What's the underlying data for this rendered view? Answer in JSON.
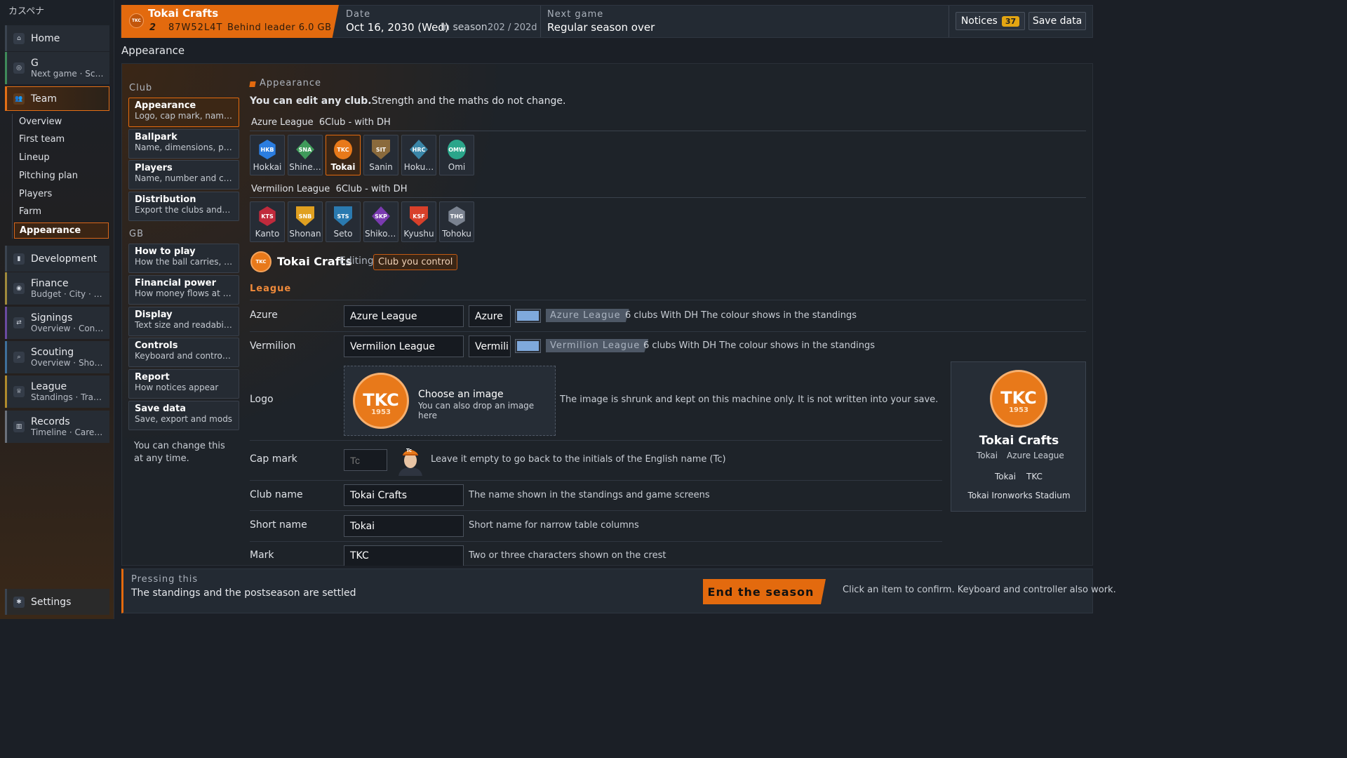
{
  "app": {
    "title": "カスペナ"
  },
  "sidebar": {
    "items": [
      {
        "label": "Home",
        "icon": "home-icon"
      },
      {
        "label": "G",
        "sub": "Next game · Sc…",
        "icon": "baseball-icon"
      },
      {
        "label": "Team",
        "icon": "team-icon"
      },
      {
        "label": "Development",
        "icon": "chart-icon"
      },
      {
        "label": "Finance",
        "sub": "Budget · City · B…",
        "icon": "coin-icon"
      },
      {
        "label": "Signings",
        "sub": "Overview · Cont…",
        "icon": "transfer-icon"
      },
      {
        "label": "Scouting",
        "sub": "Overview · Shor…",
        "icon": "search-icon"
      },
      {
        "label": "League",
        "sub": "Standings · Tran…",
        "icon": "trophy-icon"
      },
      {
        "label": "Records",
        "sub": "Timeline · Care…",
        "icon": "book-icon"
      }
    ],
    "team_sub": [
      "Overview",
      "First team",
      "Lineup",
      "Pitching plan",
      "Players",
      "Farm",
      "Appearance"
    ],
    "settings": "Settings"
  },
  "header": {
    "club_name": "Tokai Crafts",
    "club_rank": "2",
    "club_code": "87W52L4T",
    "club_status": "Behind leader 6.0 GB",
    "club_mark": "TKC",
    "date_label": "Date",
    "date_value": "Oct 16, 2030 (Wed)",
    "season_label": "In season",
    "season_progress": "202 / 202d",
    "next_label": "Next game",
    "next_value": "Regular season over",
    "notices_label": "Notices",
    "notices_count": "37",
    "save_label": "Save data"
  },
  "page": {
    "title": "Appearance"
  },
  "menu": {
    "club_label": "Club",
    "club_cards": [
      {
        "title": "Appearance",
        "desc": "Logo, cap mark, name…"
      },
      {
        "title": "Ballpark",
        "desc": "Name, dimensions, pa…"
      },
      {
        "title": "Players",
        "desc": "Name, number and ca…"
      },
      {
        "title": "Distribution",
        "desc": "Export the clubs and …"
      }
    ],
    "gb_label": "GB",
    "gb_cards": [
      {
        "title": "How to play",
        "desc": "How the ball carries, …"
      },
      {
        "title": "Financial power",
        "desc": "How money flows at e…"
      },
      {
        "title": "Display",
        "desc": "Text size and readability"
      },
      {
        "title": "Controls",
        "desc": "Keyboard and controller"
      },
      {
        "title": "Report",
        "desc": "How notices appear"
      },
      {
        "title": "Save data",
        "desc": "Save, export and mods"
      }
    ],
    "note": "You can change this at any time."
  },
  "appearance": {
    "section_label": "Appearance",
    "intro_bold": "You can edit any club.",
    "intro_rest": "Strength and the maths do not change.",
    "leagues": [
      {
        "name": "Azure League",
        "meta": "6Club - with DH",
        "clubs": [
          {
            "mark": "HKB",
            "name": "Hokkai",
            "color": "#2b7de0",
            "shape": "hex"
          },
          {
            "mark": "SNA",
            "name": "Shine…",
            "color": "#3f9a5a",
            "shape": "dia"
          },
          {
            "mark": "TKC",
            "name": "Tokai",
            "color": "#e8791a",
            "shape": "circle"
          },
          {
            "mark": "SIT",
            "name": "Sanin",
            "color": "#8a6a3c",
            "shape": "shield"
          },
          {
            "mark": "HRC",
            "name": "Hoku…",
            "color": "#3a86a8",
            "shape": "dia"
          },
          {
            "mark": "OMW",
            "name": "Omi",
            "color": "#2aa58a",
            "shape": "circle"
          }
        ]
      },
      {
        "name": "Vermilion League",
        "meta": "6Club - with DH",
        "clubs": [
          {
            "mark": "KTS",
            "name": "Kanto",
            "color": "#c02a3c",
            "shape": "hex"
          },
          {
            "mark": "SNB",
            "name": "Shonan",
            "color": "#e0a020",
            "shape": "shield"
          },
          {
            "mark": "STS",
            "name": "Seto",
            "color": "#2a7ab0",
            "shape": "shield"
          },
          {
            "mark": "SKP",
            "name": "Shikoku",
            "color": "#7a3ab0",
            "shape": "dia"
          },
          {
            "mark": "KSF",
            "name": "Kyushu",
            "color": "#d8402a",
            "shape": "shield"
          },
          {
            "mark": "THG",
            "name": "Tohoku",
            "color": "#7a8290",
            "shape": "hex"
          }
        ]
      }
    ],
    "editing": {
      "mark": "TKC",
      "name": "Tokai Crafts",
      "status": "Editing",
      "tag": "Club you control"
    },
    "league_section": "League",
    "league_rows": [
      {
        "label": "Azure",
        "full": "Azure League",
        "short": "Azure",
        "chip": "Azure League",
        "hint": "6 clubs With DH The colour shows in the standings",
        "color": "#7fa9dc"
      },
      {
        "label": "Vermilion",
        "full": "Vermilion League",
        "short": "Vermili",
        "chip": "Vermilion League",
        "hint": "6 clubs With DH The colour shows in the standings",
        "color": "#7fa9dc"
      }
    ],
    "logo": {
      "label": "Logo",
      "mark": "TKC",
      "year": "1953",
      "choose": "Choose an image",
      "drop": "You can also drop an image here",
      "hint": "The image is shrunk and kept on this machine only. It is not written into your save."
    },
    "cap": {
      "label": "Cap mark",
      "placeholder": "Tc",
      "avatar_mark": "Tc",
      "hint": "Leave it empty to go back to the initials of the English name (Tc)"
    },
    "fields": [
      {
        "label": "Club name",
        "value": "Tokai Crafts",
        "hint": "The name shown in the standings and game screens"
      },
      {
        "label": "Short name",
        "value": "Tokai",
        "hint": "Short name for narrow table columns"
      },
      {
        "label": "Mark",
        "value": "TKC",
        "hint": "Two or three characters shown on the crest"
      }
    ],
    "preview": {
      "mark": "TKC",
      "year": "1953",
      "name": "Tokai Crafts",
      "short": "Tokai",
      "league": "Azure League",
      "short2": "Tokai",
      "code": "TKC",
      "stadium": "Tokai Ironworks Stadium"
    }
  },
  "footer": {
    "label": "Pressing this",
    "desc": "The standings and the postseason are settled",
    "button": "End the season",
    "hint": "Click an item to confirm. Keyboard and controller also work."
  },
  "colors": {
    "accent": "#e36a0e",
    "bg": "#1b1f26",
    "panel": "#232a33"
  }
}
